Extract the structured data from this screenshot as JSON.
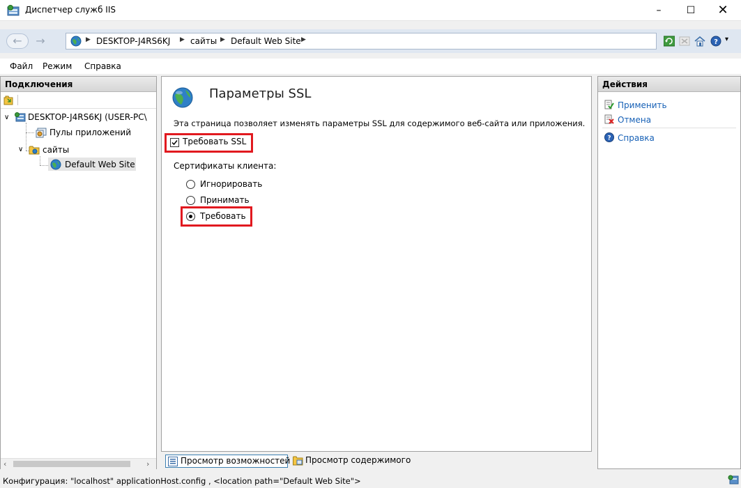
{
  "window": {
    "title": "Диспетчер служб IIS",
    "minimize_label": "–",
    "maximize_label": "☐",
    "close_label": "✕"
  },
  "address": {
    "crumbs": [
      "DESKTOP-J4RS6KJ",
      "сайты",
      "Default Web Site"
    ]
  },
  "menu": [
    "Файл",
    "Режим",
    "Справка"
  ],
  "connections": {
    "header": "Подключения",
    "tree": {
      "server": "DESKTOP-J4RS6KJ (USER-PC\\",
      "app_pools": "Пулы приложений",
      "sites": "сайты",
      "default_site": "Default Web Site"
    }
  },
  "main": {
    "title": "Параметры SSL",
    "description": "Эта страница позволяет изменять параметры SSL для содержимого веб-сайта или приложения.",
    "require_ssl_label": "Требовать SSL",
    "require_ssl_checked": true,
    "client_certs_label": "Сертификаты клиента:",
    "options": [
      "Игнорировать",
      "Принимать",
      "Требовать"
    ],
    "selected_option": "Требовать"
  },
  "views": {
    "features": "Просмотр возможностей",
    "content": "Просмотр содержимого"
  },
  "actions": {
    "header": "Действия",
    "apply": "Применить",
    "cancel": "Отмена",
    "help": "Справка"
  },
  "status": {
    "text": "Конфигурация: \"localhost\" applicationHost.config , <location path=\"Default Web Site\">"
  },
  "colors": {
    "highlight": "#e1191f",
    "link": "#1660b6",
    "address_bar": "#dfe7f1"
  }
}
